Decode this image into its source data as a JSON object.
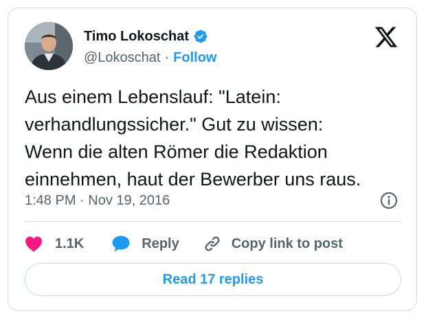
{
  "author": {
    "display_name": "Timo Lokoschat",
    "handle": "@Lokoschat",
    "separator": "·",
    "follow_label": "Follow",
    "verified": true
  },
  "tweet": {
    "lines": [
      "Aus einem Lebenslauf: \"Latein:",
      "verhandlungssicher.\" Gut zu wissen:",
      "Wenn die alten Römer die Redaktion",
      "einnehmen, haut der Bewerber uns raus."
    ],
    "timestamp": "1:48 PM · Nov 19, 2016"
  },
  "actions": {
    "like_count": "1.1K",
    "reply_label": "Reply",
    "copy_link_label": "Copy link to post"
  },
  "replies_button": {
    "label": "Read 17 replies"
  },
  "icons": {
    "verified": "verified-badge-icon",
    "platform": "x-logo-icon",
    "info": "info-icon",
    "like": "heart-icon",
    "reply": "speech-bubble-icon",
    "copy_link": "link-icon"
  },
  "colors": {
    "accent": "#1d9bf0",
    "text": "#0f1419",
    "muted": "#536471",
    "border": "#cfd9de",
    "like": "#f91880"
  }
}
